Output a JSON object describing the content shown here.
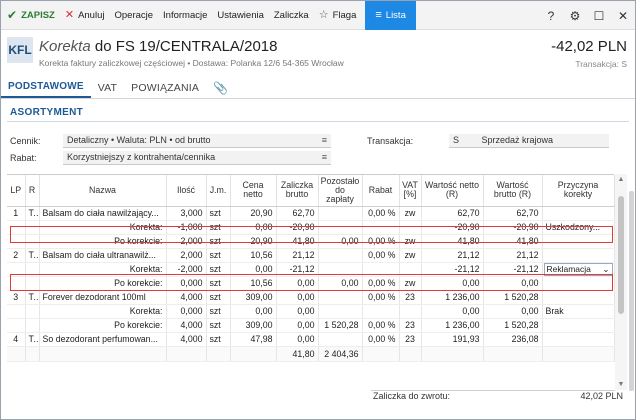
{
  "toolbar": {
    "save": "ZAPISZ",
    "cancel": "Anuluj",
    "operations": "Operacje",
    "information": "Informacje",
    "settings": "Ustawienia",
    "advance": "Zaliczka",
    "flag": "Flaga",
    "list": "Lista",
    "help": "?",
    "accent_color": "#1e88e5"
  },
  "header": {
    "badge": "KFL",
    "doc_kind": "Korekta",
    "doc_ref": "do FS 19/CENTRALA/2018",
    "subtitle": "Korekta faktury zaliczkowej częściowej  •  Dostawa: Polanka  12/6  54-365 Wrocław",
    "amount": "-42,02 PLN",
    "transaction_label": "Transakcja: S"
  },
  "tabs": [
    {
      "label": "PODSTAWOWE",
      "active": true
    },
    {
      "label": "VAT",
      "active": false
    },
    {
      "label": "POWIĄZANIA",
      "active": false
    }
  ],
  "section": {
    "title": "ASORTYMENT",
    "pricelist_label": "Cennik:",
    "pricelist_value": "Detaliczny • Waluta: PLN • od brutto",
    "discount_label": "Rabat:",
    "discount_value": "Korzystniejszy z kontrahenta/cennika",
    "transaction_label": "Transakcja:",
    "transaction_code": "S",
    "transaction_value": "Sprzedaż krajowa"
  },
  "table": {
    "columns": [
      "LP",
      "R",
      "Nazwa",
      "Ilość",
      "J.m.",
      "Cena netto",
      "Zaliczka brutto",
      "Pozostało do zapłaty",
      "Rabat",
      "VAT [%]",
      "Wartość netto (R)",
      "Wartość brutto (R)",
      "Przyczyna korekty"
    ],
    "rows": [
      [
        "1",
        "T...",
        "Balsam do ciała nawilżający...",
        "3,000",
        "szt",
        "20,90",
        "62,70",
        "",
        "0,00 %",
        "zw",
        "62,70",
        "62,70",
        ""
      ],
      [
        "",
        "",
        "Korekta:",
        "-1,000",
        "szt",
        "0,00",
        "-20,90",
        "",
        "",
        "",
        "-20,90",
        "-20,90",
        "Uszkodzony..."
      ],
      [
        "",
        "",
        "Po korekcie:",
        "2,000",
        "szt",
        "20,90",
        "41,80",
        "0,00",
        "0,00 %",
        "zw",
        "41,80",
        "41,80",
        ""
      ],
      [
        "2",
        "T...",
        "Balsam do ciała ultranawilż...",
        "2,000",
        "szt",
        "10,56",
        "21,12",
        "",
        "0,00 %",
        "zw",
        "21,12",
        "21,12",
        ""
      ],
      [
        "",
        "",
        "Korekta:",
        "-2,000",
        "szt",
        "0,00",
        "-21,12",
        "",
        "",
        "",
        "-21,12",
        "-21,12",
        "Reklamacja"
      ],
      [
        "",
        "",
        "Po korekcie:",
        "0,000",
        "szt",
        "10,56",
        "0,00",
        "0,00",
        "0,00 %",
        "zw",
        "0,00",
        "0,00",
        ""
      ],
      [
        "3",
        "T...",
        "Forever dezodorant 100ml",
        "4,000",
        "szt",
        "309,00",
        "0,00",
        "",
        "0,00 %",
        "23",
        "1 236,00",
        "1 520,28",
        ""
      ],
      [
        "",
        "",
        "Korekta:",
        "0,000",
        "szt",
        "0,00",
        "0,00",
        "",
        "",
        "",
        "0,00",
        "0,00",
        "Brak"
      ],
      [
        "",
        "",
        "Po korekcie:",
        "4,000",
        "szt",
        "309,00",
        "0,00",
        "1 520,28",
        "0,00 %",
        "23",
        "1 236,00",
        "1 520,28",
        ""
      ],
      [
        "4",
        "T...",
        "So dezodorant perfumowan...",
        "4,000",
        "szt",
        "47,98",
        "0,00",
        "",
        "0,00 %",
        "23",
        "191,93",
        "236,08",
        ""
      ]
    ],
    "totals": {
      "advance": "41,80",
      "remaining": "2 404,36"
    }
  },
  "footer": {
    "refund_label": "Zaliczka do zwrotu:",
    "refund_value": "42,02 PLN"
  }
}
